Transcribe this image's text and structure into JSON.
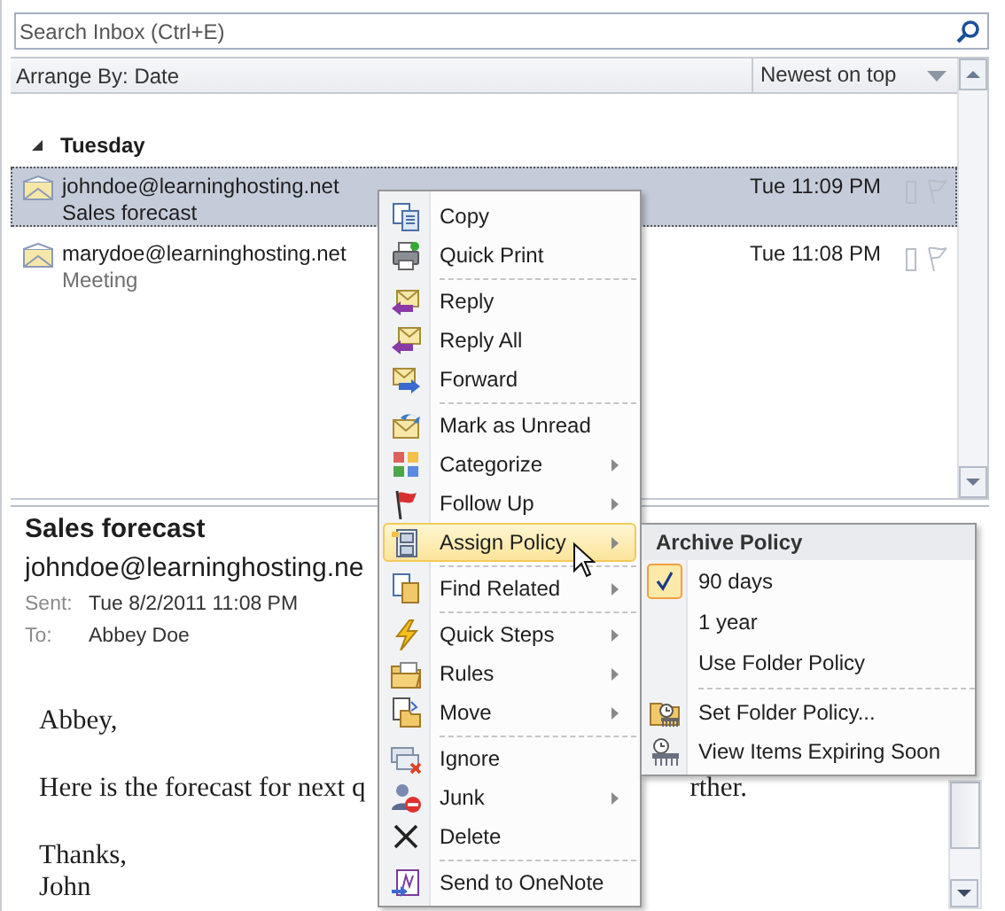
{
  "search": {
    "placeholder": "Search Inbox (Ctrl+E)"
  },
  "arrange": {
    "label": "Arrange By: Date",
    "order": "Newest on top"
  },
  "group": {
    "label": "Tuesday",
    "expanded": true
  },
  "messages": [
    {
      "sender": "johndoe@learninghosting.net",
      "subject": "Sales forecast",
      "time": "Tue 11:09 PM",
      "selected": true
    },
    {
      "sender": "marydoe@learninghosting.net",
      "subject": "Meeting",
      "time": "Tue 11:08 PM",
      "selected": false
    }
  ],
  "reading_pane": {
    "subject": "Sales forecast",
    "from": "johndoe@learninghosting.ne",
    "sent_label": "Sent:",
    "sent": "Tue 8/2/2011 11:08 PM",
    "to_label": "To:",
    "to": "Abbey Doe",
    "body": [
      "Abbey,",
      [
        "Here is the forecast for next q",
        "rther."
      ],
      "Thanks,",
      "John"
    ]
  },
  "context_menu": {
    "groups": [
      [
        {
          "label": "Copy",
          "submenu": false,
          "selected": false
        },
        {
          "label": "Quick Print",
          "submenu": false,
          "selected": false
        }
      ],
      [
        {
          "label": "Reply",
          "submenu": false,
          "selected": false
        },
        {
          "label": "Reply All",
          "submenu": false,
          "selected": false
        },
        {
          "label": "Forward",
          "submenu": false,
          "selected": false
        }
      ],
      [
        {
          "label": "Mark as Unread",
          "submenu": false,
          "selected": false
        },
        {
          "label": "Categorize",
          "submenu": true,
          "selected": false
        },
        {
          "label": "Follow Up",
          "submenu": true,
          "selected": false
        },
        {
          "label": "Assign Policy",
          "submenu": true,
          "selected": true
        }
      ],
      [
        {
          "label": "Find Related",
          "submenu": true,
          "selected": false
        }
      ],
      [
        {
          "label": "Quick Steps",
          "submenu": true,
          "selected": false
        },
        {
          "label": "Rules",
          "submenu": true,
          "selected": false
        },
        {
          "label": "Move",
          "submenu": true,
          "selected": false
        }
      ],
      [
        {
          "label": "Ignore",
          "submenu": false,
          "selected": false
        },
        {
          "label": "Junk",
          "submenu": true,
          "selected": false
        },
        {
          "label": "Delete",
          "submenu": false,
          "selected": false
        }
      ],
      [
        {
          "label": "Send to OneNote",
          "submenu": false,
          "selected": false
        }
      ]
    ]
  },
  "submenu": {
    "header": "Archive Policy",
    "groups": [
      [
        {
          "label": "90 days",
          "checked": true
        },
        {
          "label": "1 year",
          "checked": false
        },
        {
          "label": "Use Folder Policy",
          "checked": false
        }
      ],
      [
        {
          "label": "Set Folder Policy...",
          "checked": false
        },
        {
          "label": "View Items Expiring Soon",
          "checked": false
        }
      ]
    ]
  }
}
